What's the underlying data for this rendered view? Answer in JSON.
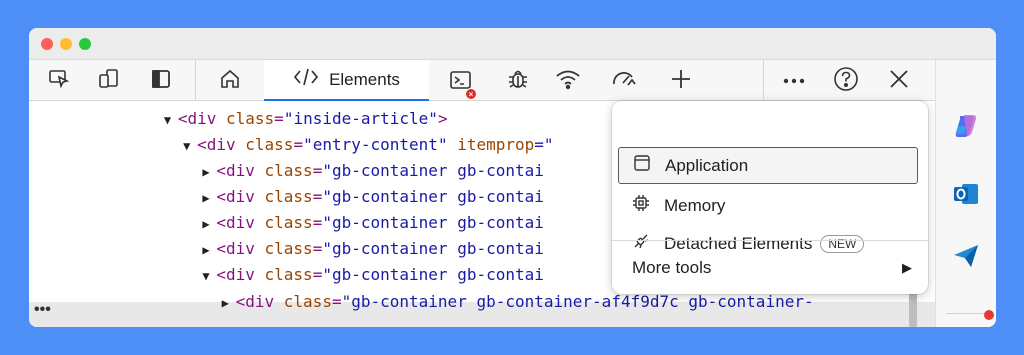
{
  "toolbar": {
    "tabs": {
      "elements": {
        "label": "Elements"
      }
    },
    "icons": [
      "inspect-icon",
      "device-emulation-icon",
      "dock-icon",
      "welcome-home-icon",
      "console-icon",
      "sources-bug-icon",
      "network-wifi-icon",
      "performance-icon",
      "more-tools-plus-icon",
      "more-options-icon",
      "help-icon",
      "close-icon"
    ]
  },
  "dom_tree": {
    "lines": [
      {
        "indent": 14,
        "tri": "▼",
        "tag": "div",
        "attr": "class",
        "val": "\"inside-article\"",
        "tail": ">"
      },
      {
        "indent": 16,
        "tri": "▼",
        "tag": "div",
        "attr": "class",
        "val": "\"entry-content\"",
        "extra_attr": "itemprop",
        "extra_val": "=\"",
        "tail": ""
      },
      {
        "indent": 18,
        "tri": "▶",
        "tag": "div",
        "attr": "class",
        "val": "\"gb-container gb-contai",
        "tail": ""
      },
      {
        "indent": 18,
        "tri": "▶",
        "tag": "div",
        "attr": "class",
        "val": "\"gb-container gb-contai",
        "tail": ""
      },
      {
        "indent": 18,
        "tri": "▶",
        "tag": "div",
        "attr": "class",
        "val": "\"gb-container gb-contai",
        "tail": ""
      },
      {
        "indent": 18,
        "tri": "▶",
        "tag": "div",
        "attr": "class",
        "val": "\"gb-container gb-contai",
        "tail": ""
      },
      {
        "indent": 18,
        "tri": "▼",
        "tag": "div",
        "attr": "class",
        "val": "\"gb-container gb-contai",
        "tail": ""
      },
      {
        "indent": 20,
        "tri": "▶",
        "tag": "div",
        "attr": "class",
        "val": "\"gb-container gb-container-af4f9d7c gb-container-",
        "tail": ""
      }
    ],
    "gutter_dots": "•••"
  },
  "dropdown": {
    "items": [
      {
        "label": "Application",
        "icon": "application-icon",
        "selected": true
      },
      {
        "label": "Memory",
        "icon": "memory-chip-icon",
        "selected": false
      },
      {
        "label": "Detached Elements",
        "icon": "detached-elements-icon",
        "selected": false,
        "badge": "NEW"
      }
    ],
    "more_tools": {
      "label": "More tools",
      "arrow": "▶"
    }
  },
  "sidebar": {
    "icons": [
      "copilot-icon",
      "outlook-icon",
      "send-icon"
    ]
  },
  "colors": {
    "background": "#4d8ef7",
    "tag": "#881280",
    "attr": "#994500",
    "value": "#1a1aa6",
    "accent": "#1a73e8"
  }
}
